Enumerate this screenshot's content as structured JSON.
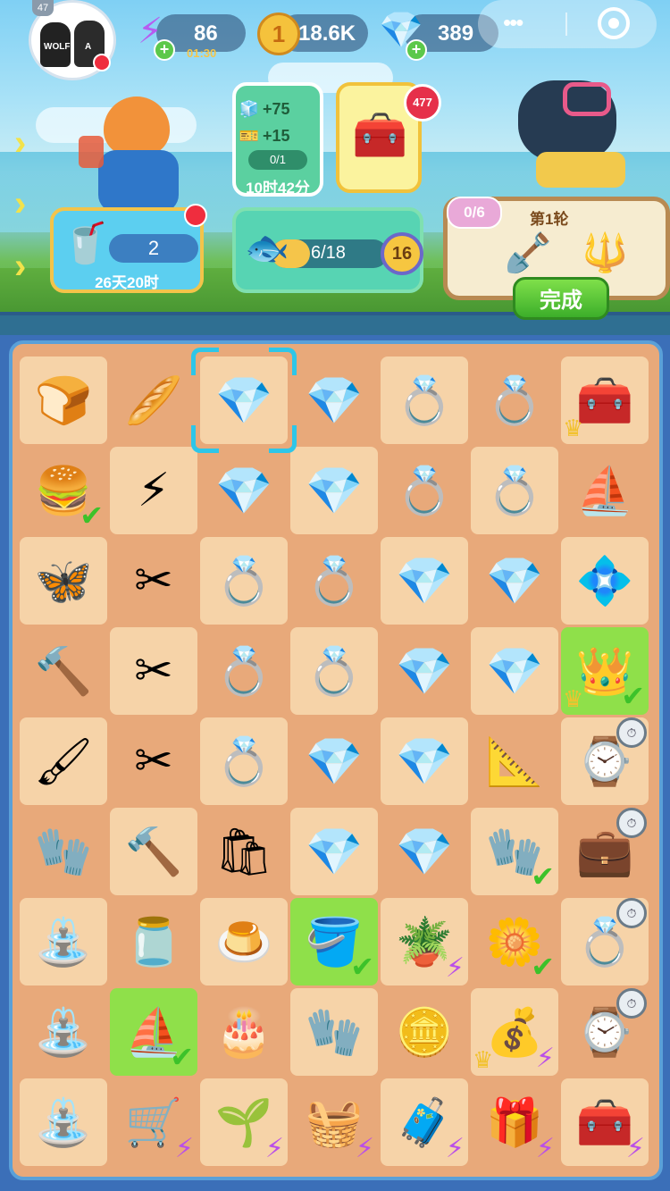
{
  "colors": {
    "accent_check": "#3cc22a",
    "bolt": "#b94fe8",
    "done_button": "#3cae2a"
  },
  "top_bar": {
    "level": "47",
    "energy": {
      "value": "86",
      "timer": "01:30"
    },
    "coins": {
      "value": "18.6K"
    },
    "gems": {
      "value": "389"
    }
  },
  "events": {
    "tea": {
      "count": "2",
      "time_left": "26天20时"
    },
    "fish": {
      "progress": "6/18",
      "level": "16",
      "fraction": 0.33
    },
    "reward": {
      "gem_bonus": "+75",
      "ticket_bonus": "+15",
      "claimed": "0/1",
      "time_left": "10时42分"
    },
    "box": {
      "badge": "477"
    },
    "round": {
      "title": "第1轮",
      "progress": "0/6",
      "done_label": "完成"
    }
  },
  "board": {
    "rows": [
      [
        {
          "item": "bread-bun-icon",
          "g": "🍞"
        },
        {
          "item": "bread-loaf-icon",
          "g": "🥖"
        },
        {
          "item": "crystal-icon",
          "g": "💎"
        },
        {
          "item": "crystal-icon",
          "g": "💎"
        },
        {
          "item": "ring-icon",
          "g": "💍"
        },
        {
          "item": "ring-icon",
          "g": "💍"
        },
        {
          "item": "toolbox-ship-icon",
          "g": "🧰",
          "crown": true
        }
      ],
      [
        {
          "item": "burger-icon",
          "g": "🍔",
          "check": true
        },
        {
          "item": "energy-bubble-icon",
          "g": "⚡"
        },
        {
          "item": "crystal-icon",
          "g": "💎"
        },
        {
          "item": "crystal-icon",
          "g": "💎"
        },
        {
          "item": "ring-icon",
          "g": "💍"
        },
        {
          "item": "ring-icon",
          "g": "💍"
        },
        {
          "item": "paper-boat-icon",
          "g": "⛵"
        }
      ],
      [
        {
          "item": "butterfly-icon",
          "g": "🦋"
        },
        {
          "item": "pliers-icon",
          "g": "✂"
        },
        {
          "item": "ring-icon",
          "g": "💍"
        },
        {
          "item": "ring-icon",
          "g": "💍"
        },
        {
          "item": "crystal-icon",
          "g": "💎"
        },
        {
          "item": "crystal-icon",
          "g": "💎"
        },
        {
          "item": "earrings-icon",
          "g": "💠"
        }
      ],
      [
        {
          "item": "mallet-icon",
          "g": "🔨"
        },
        {
          "item": "pliers-icon",
          "g": "✂"
        },
        {
          "item": "ring-icon",
          "g": "💍"
        },
        {
          "item": "ring-icon",
          "g": "💍"
        },
        {
          "item": "crystal-icon",
          "g": "💎"
        },
        {
          "item": "crystal-icon",
          "g": "💎"
        },
        {
          "item": "crown-icon",
          "g": "👑",
          "green": true,
          "check": true,
          "crown": true
        }
      ],
      [
        {
          "item": "paint-roller-icon",
          "g": "🖌"
        },
        {
          "item": "pliers-icon",
          "g": "✂"
        },
        {
          "item": "ring-icon",
          "g": "💍"
        },
        {
          "item": "crystal-icon",
          "g": "💎"
        },
        {
          "item": "crystal-icon",
          "g": "💎"
        },
        {
          "item": "compass-icon",
          "g": "📐"
        },
        {
          "item": "watch-box-icon",
          "g": "⌚",
          "timer": true
        }
      ],
      [
        {
          "item": "gloves-icon",
          "g": "🧤"
        },
        {
          "item": "mallet-icon",
          "g": "🔨"
        },
        {
          "item": "seed-bag-icon",
          "g": "🛍"
        },
        {
          "item": "crystal-icon",
          "g": "💎"
        },
        {
          "item": "crystal-icon",
          "g": "💎"
        },
        {
          "item": "garden-gloves-icon",
          "g": "🧤",
          "check": true
        },
        {
          "item": "jewelry-box-icon",
          "g": "💼",
          "timer": true
        }
      ],
      [
        {
          "item": "fountain-icon",
          "g": "⛲"
        },
        {
          "item": "ink-jar-icon",
          "g": "🫙"
        },
        {
          "item": "pudding-icon",
          "g": "🍮"
        },
        {
          "item": "trowel-icon",
          "g": "🪣",
          "green": true,
          "check": true
        },
        {
          "item": "plant-pot-icon",
          "g": "🪴",
          "bolt": true
        },
        {
          "item": "flower-pot-icon",
          "g": "🌼",
          "check": true
        },
        {
          "item": "ring-box-icon",
          "g": "💍",
          "timer": true
        }
      ],
      [
        {
          "item": "fountain-icon",
          "g": "⛲"
        },
        {
          "item": "paper-ship-icon",
          "g": "⛵",
          "green": true,
          "check": true
        },
        {
          "item": "cake-icon",
          "g": "🎂"
        },
        {
          "item": "work-gloves-icon",
          "g": "🧤"
        },
        {
          "item": "coins-icon",
          "g": "🪙"
        },
        {
          "item": "soil-sack-icon",
          "g": "💰",
          "bolt": true,
          "crown": true
        },
        {
          "item": "watch-box-icon",
          "g": "⌚",
          "timer": true
        }
      ],
      [
        {
          "item": "fountain-icon",
          "g": "⛲"
        },
        {
          "item": "garden-cart-icon",
          "g": "🛒",
          "bolt": true
        },
        {
          "item": "sprout-pot-icon",
          "g": "🌱",
          "bolt": true
        },
        {
          "item": "seed-tray-icon",
          "g": "🧺",
          "bolt": true
        },
        {
          "item": "cooler-box-icon",
          "g": "🧳",
          "bolt": true
        },
        {
          "item": "pink-box-icon",
          "g": "🎁",
          "bolt": true
        },
        {
          "item": "tool-chest-icon",
          "g": "🧰",
          "bolt": true
        }
      ]
    ],
    "selected": {
      "row": 0,
      "col": 2
    }
  }
}
